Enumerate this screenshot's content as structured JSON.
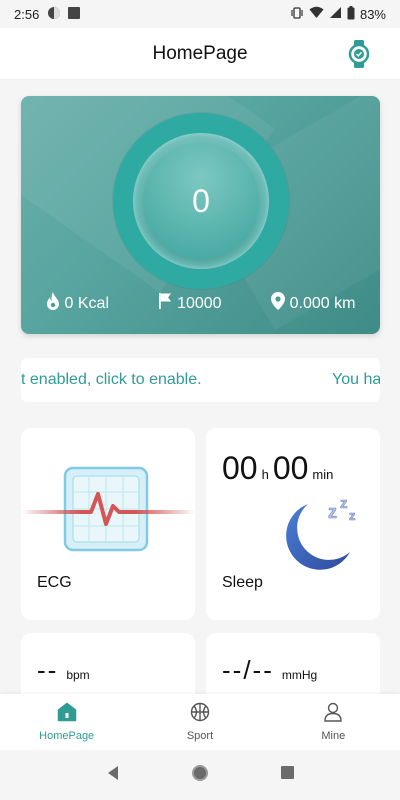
{
  "status_bar": {
    "time": "2:56",
    "battery": "83%"
  },
  "header": {
    "title": "HomePage",
    "watch_icon": "watch-check-icon"
  },
  "hero": {
    "steps": "0",
    "calories": "0 Kcal",
    "goal": "10000",
    "distance": "0.000 km",
    "accent_color": "#2faaa3"
  },
  "notice": {
    "text_visible": "t enabled, click to enable.",
    "text_next": "You ha"
  },
  "cards": {
    "ecg": {
      "label": "ECG"
    },
    "sleep": {
      "label": "Sleep",
      "hours": "00",
      "hours_unit": "h",
      "minutes": "00",
      "minutes_unit": "min"
    },
    "heart_rate": {
      "value": "--",
      "unit": "bpm"
    },
    "blood_pressure": {
      "value": "--/--",
      "unit": "mmHg"
    }
  },
  "bottom_nav": {
    "items": [
      {
        "label": "HomePage",
        "icon": "home-icon",
        "active": true
      },
      {
        "label": "Sport",
        "icon": "basketball-icon",
        "active": false
      },
      {
        "label": "Mine",
        "icon": "person-icon",
        "active": false
      }
    ]
  },
  "colors": {
    "accent": "#2f9c95",
    "background": "#f5f5f5"
  }
}
